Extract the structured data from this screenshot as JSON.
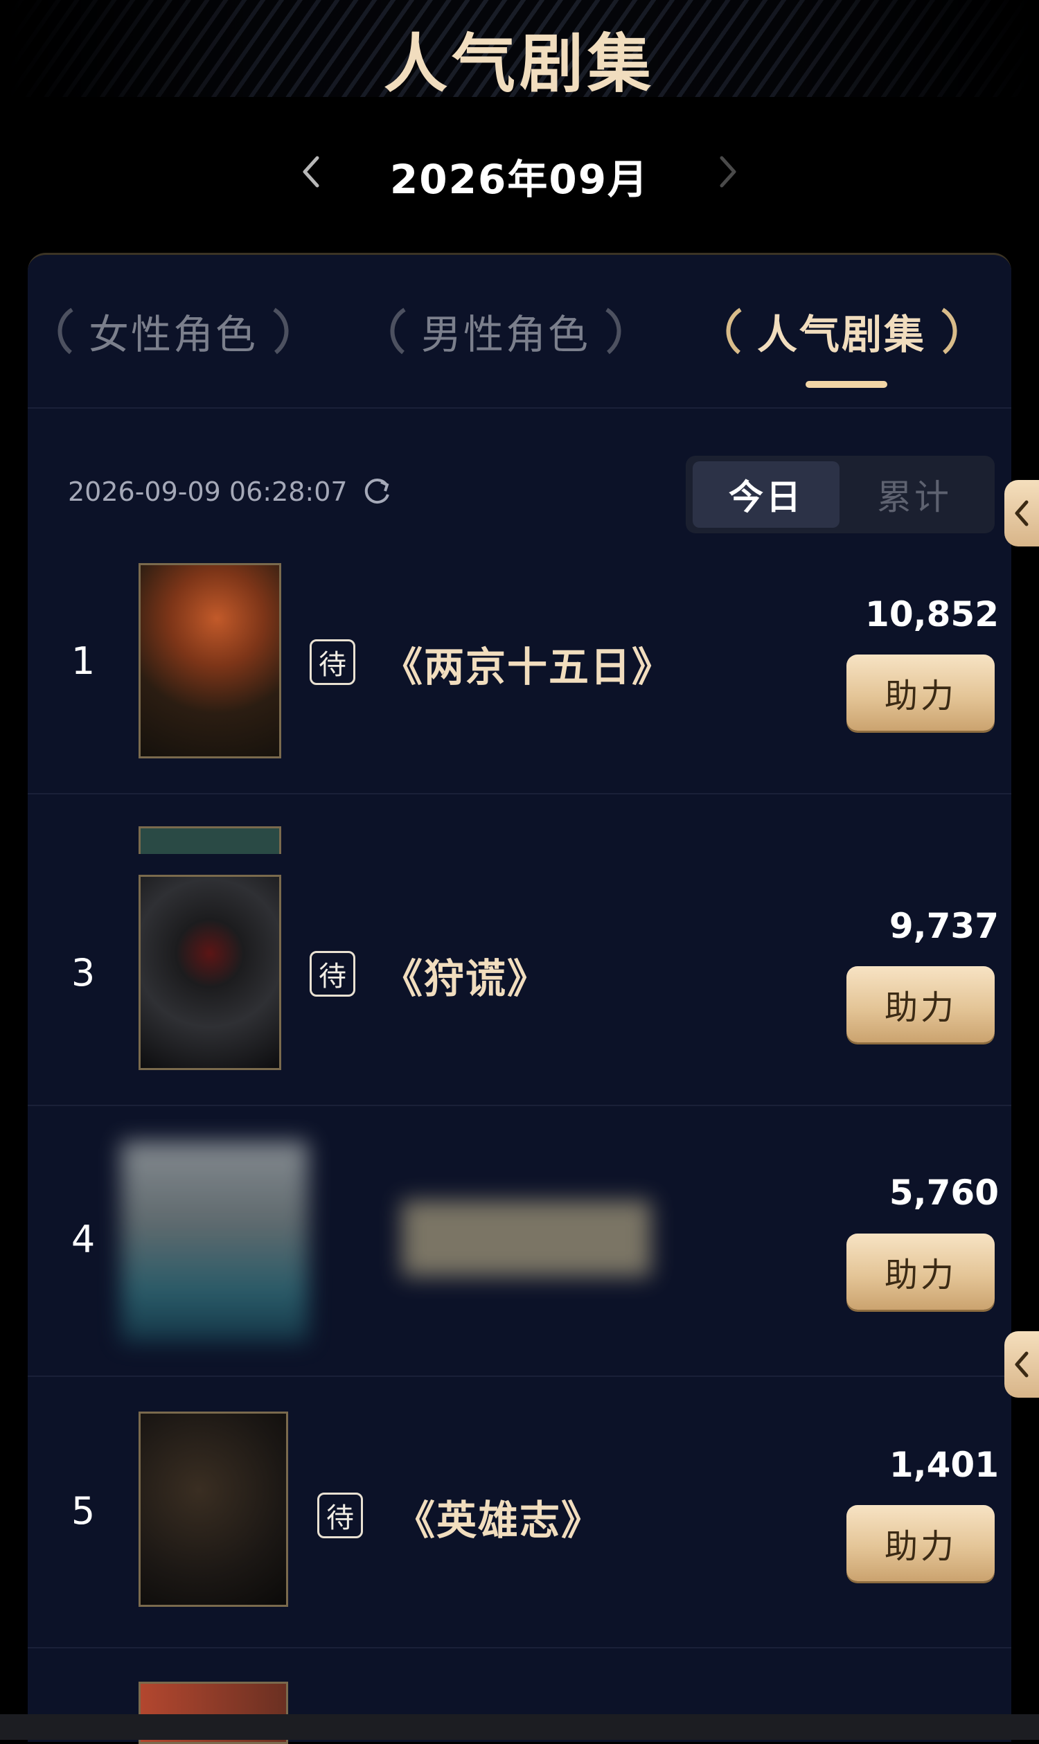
{
  "header": {
    "title": "人气剧集",
    "month": "2026年09月"
  },
  "tabs": [
    {
      "label": "女性角色",
      "active": false
    },
    {
      "label": "男性角色",
      "active": false
    },
    {
      "label": "人气剧集",
      "active": true
    }
  ],
  "status": {
    "updated_at": "2026-09-09 06:28:07"
  },
  "toggle": {
    "today": "今日",
    "total": "累计",
    "selected": "今日"
  },
  "list": {
    "items": [
      {
        "rank": "1",
        "badge": "待",
        "title": "《两京十五日》",
        "count": "10,852",
        "action": "助力"
      },
      {
        "rank": "3",
        "badge": "待",
        "title": "《狩谎》",
        "count": "9,737",
        "action": "助力"
      },
      {
        "rank": "4",
        "badge": "",
        "title": "",
        "count": "5,760",
        "action": "助力"
      },
      {
        "rank": "5",
        "badge": "待",
        "title": "《英雄志》",
        "count": "1,401",
        "action": "助力"
      }
    ]
  },
  "colors": {
    "accent_gold": "#f1ddbe",
    "button_gold": "#e4c597",
    "panel_bg": "#0c1228"
  },
  "icons": [
    "chevron-left-icon",
    "chevron-right-icon",
    "laurel-left-icon",
    "laurel-right-icon",
    "refresh-icon"
  ]
}
